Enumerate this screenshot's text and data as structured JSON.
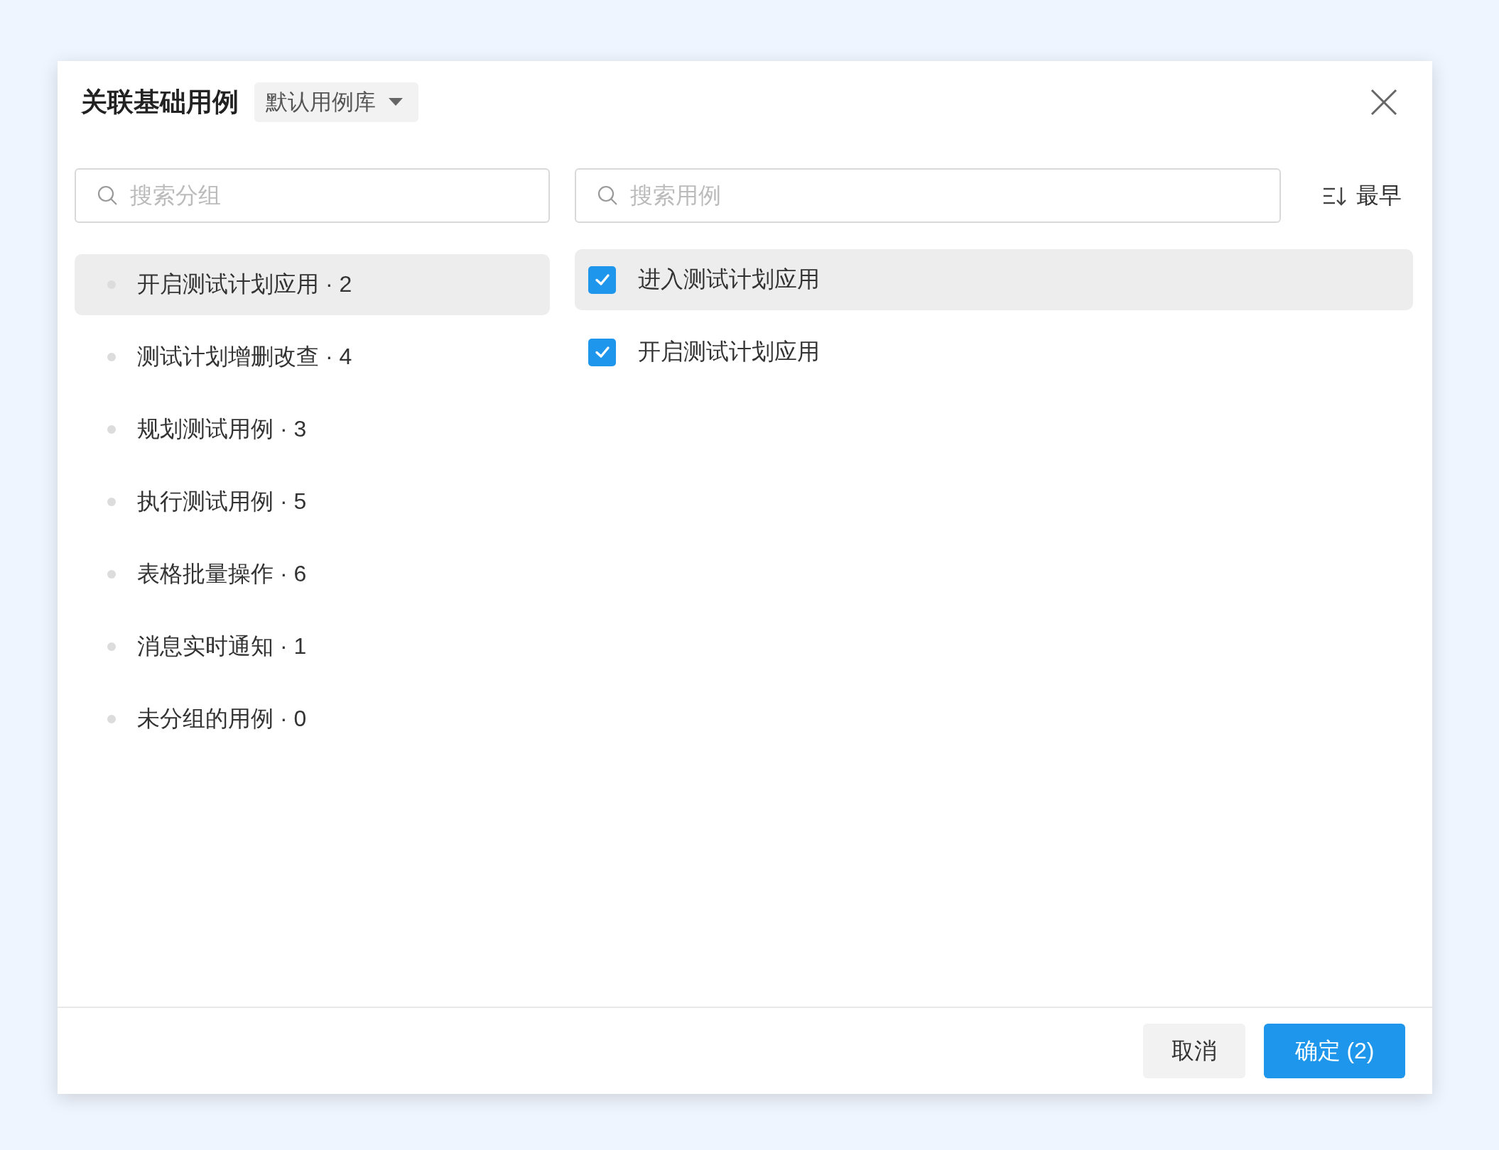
{
  "dialog": {
    "title": "关联基础用例",
    "library_select": {
      "value": "默认用例库"
    },
    "group_search": {
      "placeholder": "搜索分组"
    },
    "case_search": {
      "placeholder": "搜索用例"
    },
    "sort": {
      "label": "最早"
    },
    "groups": [
      {
        "label": "开启测试计划应用 · 2",
        "selected": true
      },
      {
        "label": "测试计划增删改查 · 4",
        "selected": false
      },
      {
        "label": "规划测试用例 · 3",
        "selected": false
      },
      {
        "label": "执行测试用例 · 5",
        "selected": false
      },
      {
        "label": "表格批量操作 · 6",
        "selected": false
      },
      {
        "label": "消息实时通知 · 1",
        "selected": false
      },
      {
        "label": "未分组的用例 · 0",
        "selected": false
      }
    ],
    "cases": [
      {
        "label": "进入测试计划应用",
        "checked": true,
        "selected": true
      },
      {
        "label": "开启测试计划应用",
        "checked": true,
        "selected": false
      }
    ],
    "buttons": [
      {
        "label": "取消",
        "kind": "secondary"
      },
      {
        "label": "确定 (2)",
        "kind": "primary"
      }
    ]
  }
}
